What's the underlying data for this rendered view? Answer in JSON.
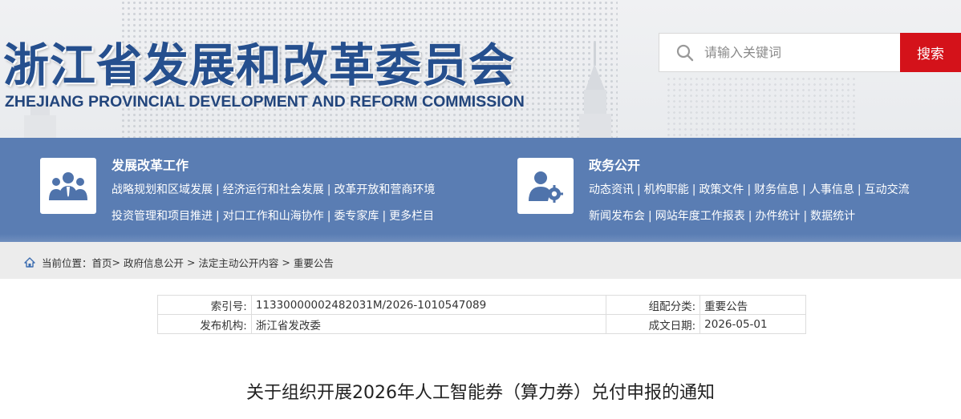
{
  "header": {
    "title": "浙江省发展和改革委员会",
    "subtitle": "ZHEJIANG PROVINCIAL DEVELOPMENT AND REFORM COMMISSION",
    "search_placeholder": "请输入关键词",
    "search_button": "搜索"
  },
  "nav": {
    "left": {
      "heading": "发展改革工作",
      "icon": "people-group-icon",
      "row1": [
        "战略规划和区域发展",
        "经济运行和社会发展",
        "改革开放和营商环境"
      ],
      "row2": [
        "投资管理和项目推进",
        "对口工作和山海协作",
        "委专家库",
        "更多栏目"
      ]
    },
    "right": {
      "heading": "政务公开",
      "icon": "user-gear-icon",
      "row1": [
        "动态资讯",
        "机构职能",
        "政策文件",
        "财务信息",
        "人事信息",
        "互动交流"
      ],
      "row2": [
        "新闻发布会",
        "网站年度工作报表",
        "办件统计",
        "数据统计"
      ]
    }
  },
  "breadcrumb": {
    "prefix": "当前位置：",
    "items": [
      "首页",
      "政府信息公开",
      "法定主动公开内容",
      "重要公告"
    ]
  },
  "meta": {
    "index_label": "索引号:",
    "index_value": "11330000002482031M/2026-1010547089",
    "category_label": "组配分类:",
    "category_value": "重要公告",
    "publisher_label": "发布机构:",
    "publisher_value": "浙江省发改委",
    "date_label": "成文日期:",
    "date_value": "2026-05-01"
  },
  "document": {
    "title": "关于组织开展2026年人工智能券（算力券）兑付申报的通知"
  },
  "colors": {
    "brand_blue": "#254f8e",
    "nav_blue": "#5a7db3",
    "search_red": "#d4121a"
  }
}
